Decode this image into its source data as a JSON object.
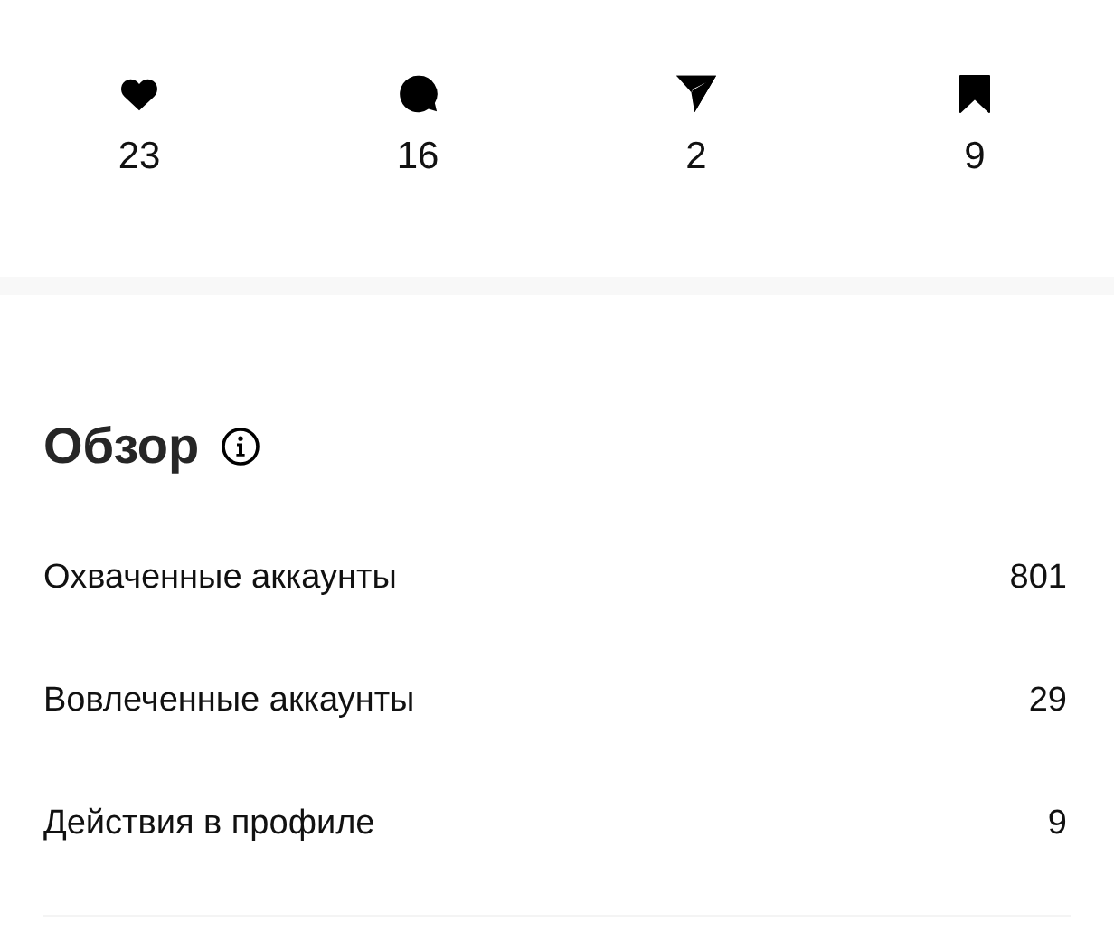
{
  "stats": [
    {
      "kind": "like",
      "count": "23"
    },
    {
      "kind": "comment",
      "count": "16"
    },
    {
      "kind": "share",
      "count": "2"
    },
    {
      "kind": "save",
      "count": "9"
    }
  ],
  "overview": {
    "title": "Обзор",
    "rows": [
      {
        "label": "Охваченные аккаунты",
        "value": "801"
      },
      {
        "label": "Вовлеченные аккаунты",
        "value": "29"
      },
      {
        "label": "Действия в профиле",
        "value": "9"
      }
    ]
  }
}
